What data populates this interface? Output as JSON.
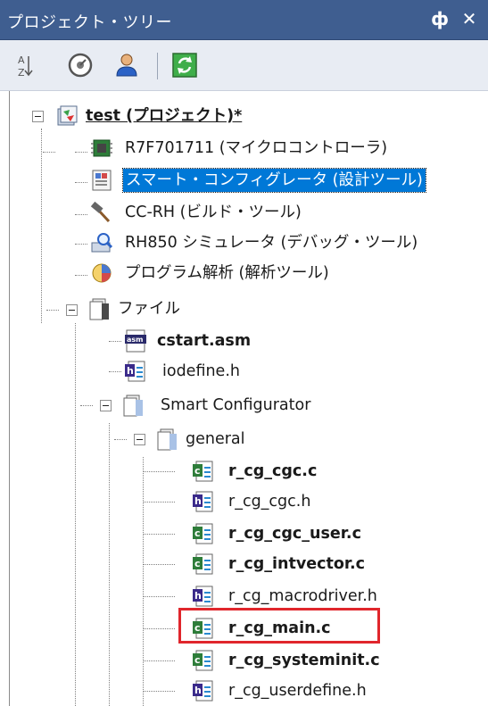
{
  "panel": {
    "title": "プロジェクト・ツリー",
    "pin_glyph": "ф",
    "close_glyph": "✕"
  },
  "toolbar": {
    "items": [
      {
        "icon": "sort-icon"
      },
      {
        "icon": "properties-icon"
      },
      {
        "icon": "user-icon"
      },
      {
        "icon": "refresh-icon"
      }
    ]
  },
  "tree": {
    "project": "test (プロジェクト)*",
    "microcontroller": "R7F701711 (マイクロコントローラ)",
    "smart_config_tool": "スマート・コンフィグレータ (設計ツール)",
    "build_tool": "CC-RH (ビルド・ツール)",
    "debug_tool": "RH850 シミュレータ (デバッグ・ツール)",
    "analysis_tool": "プログラム解析 (解析ツール)",
    "files_folder": "ファイル",
    "cstart": "cstart.asm",
    "iodefine": "iodefine.h",
    "smart_configurator": "Smart Configurator",
    "general": "general",
    "cgc_c": "r_cg_cgc.c",
    "cgc_h": "r_cg_cgc.h",
    "cgc_user": "r_cg_cgc_user.c",
    "intvector": "r_cg_intvector.c",
    "macrodriver": "r_cg_macrodriver.h",
    "main_c": "r_cg_main.c",
    "systeminit": "r_cg_systeminit.c",
    "userdefine": "r_cg_userdefine.h"
  },
  "colors": {
    "titlebar": "#3f5e90",
    "selection": "#0078d7",
    "highlight": "#e0262c"
  }
}
